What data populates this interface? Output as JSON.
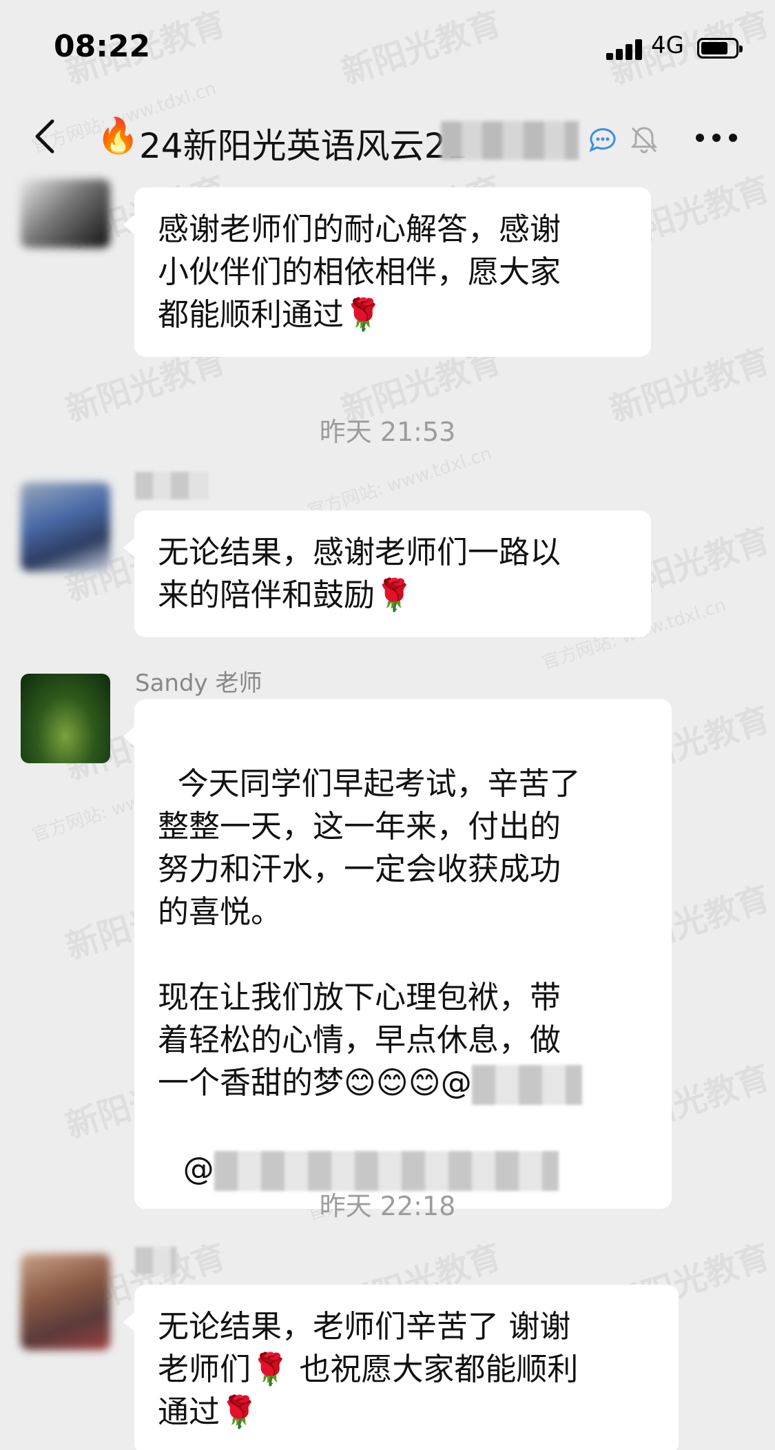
{
  "status_bar": {
    "time": "08:22",
    "network": "4G"
  },
  "nav": {
    "title": "24新阳光英语风云21",
    "icon": "fire-icon"
  },
  "watermark": {
    "text": "新阳光教育",
    "site": "官方网站: www.tdxl.cn"
  },
  "messages": [
    {
      "text": "感谢老师们的耐心解答，感谢\n小伙伴们的相依相伴，愿大家\n都能顺利通过🌹"
    },
    {
      "timestamp": "昨天 21:53"
    },
    {
      "text": "无论结果，感谢老师们一路以\n来的陪伴和鼓励🌹"
    },
    {
      "sender": "Sandy 老师",
      "text": "今天同学们早起考试，辛苦了\n整整一天，这一年来，付出的\n努力和汗水，一定会收获成功\n的喜悦。\n\n现在让我们放下心理包袱，带\n着轻松的心情，早点休息，做\n一个香甜的梦😊😊😊@",
      "mention2": "@"
    },
    {
      "timestamp": "昨天 22:18"
    },
    {
      "text": "无论结果，老师们辛苦了 谢谢\n老师们🌹 也祝愿大家都能顺利\n通过🌹"
    }
  ]
}
